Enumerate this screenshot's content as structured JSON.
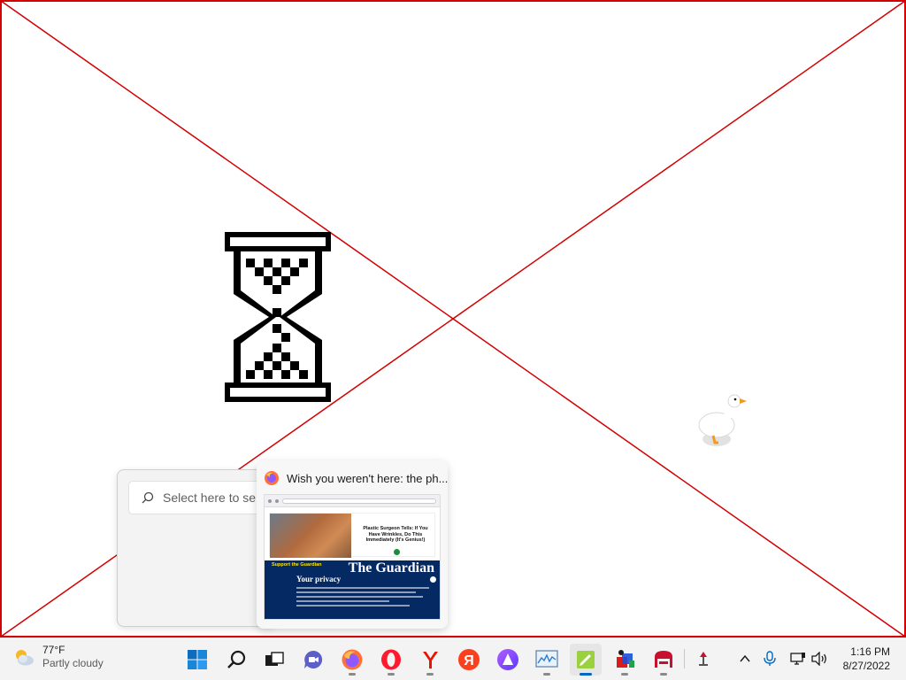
{
  "search": {
    "placeholder": "Select here to se"
  },
  "thumbnail": {
    "title": "Wish you weren't here: the ph...",
    "ad_text": "Plastic Surgeon Tells: If You Have Wrinkles, Do This Immediately (It's Genius!)",
    "support_text": "Support the Guardian",
    "logo_text": "The Guardian",
    "privacy_title": "Your privacy"
  },
  "weather": {
    "temperature": "77°F",
    "condition": "Partly cloudy"
  },
  "clock": {
    "time": "1:16 PM",
    "date": "8/27/2022"
  },
  "taskbar": {
    "apps": [
      "start",
      "search",
      "task-view",
      "chat",
      "firefox",
      "opera",
      "yandex-browser",
      "yandex",
      "alice",
      "resource-monitor",
      "notes",
      "installer",
      "paint-bucket",
      "eject-tool"
    ],
    "active_app": "notes"
  },
  "colors": {
    "x_lines": "#d40000",
    "taskbar_bg": "#f3f3f3",
    "accent": "#0067c0"
  }
}
